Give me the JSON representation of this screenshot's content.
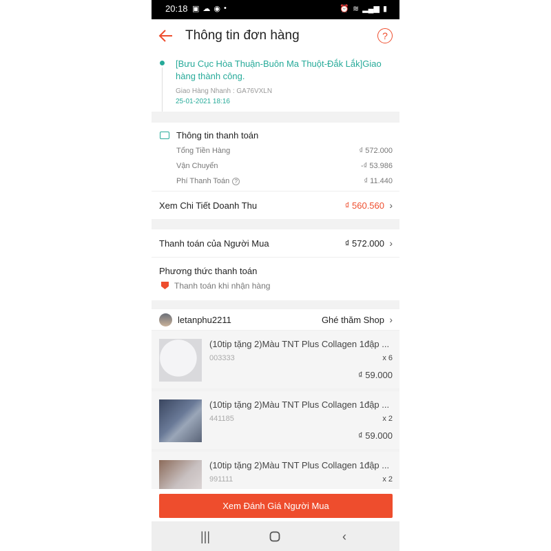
{
  "status_bar": {
    "time": "20:18",
    "icons_left": [
      "image-icon",
      "cloud-icon",
      "messenger-icon",
      "dot-icon"
    ],
    "icons_right": [
      "alarm-icon",
      "wifi-icon",
      "signal-icon",
      "battery-icon"
    ]
  },
  "header": {
    "title": "Thông tin đơn hàng"
  },
  "shipping": {
    "status": "[Bưu Cục Hòa Thuận-Buôn Ma Thuột-Đắk Lắk]Giao hàng thành công.",
    "carrier": "Giao Hàng Nhanh : GA76VXLN",
    "timestamp": "25-01-2021 18:16"
  },
  "payment": {
    "title": "Thông tin thanh toán",
    "rows": [
      {
        "label": "Tổng Tiền Hàng",
        "value": "₫ 572.000"
      },
      {
        "label": "Vận Chuyển",
        "value": "-₫ 53.986"
      },
      {
        "label": "Phí Thanh Toán",
        "value": "₫ 11.440"
      }
    ],
    "revenue_label": "Xem Chi Tiết Doanh Thu",
    "revenue_value": "₫ 560.560"
  },
  "buyer_payment": {
    "label": "Thanh toán của Người Mua",
    "value": "₫ 572.000"
  },
  "method": {
    "title": "Phương thức thanh toán",
    "value": "Thanh toán khi nhận hàng"
  },
  "shop": {
    "name": "letanphu2211",
    "visit_label": "Ghé thăm Shop"
  },
  "products": [
    {
      "name": "(10tip tặng 2)Màu TNT Plus Collagen 1đập ...",
      "variant": "003333",
      "qty": "x 6",
      "price": "₫ 59.000"
    },
    {
      "name": "(10tip tặng 2)Màu TNT Plus Collagen 1đập ...",
      "variant": "441185",
      "qty": "x 2",
      "price": "₫ 59.000"
    },
    {
      "name": "(10tip tặng 2)Màu TNT Plus Collagen 1đập ...",
      "variant": "991111",
      "qty": "x 2",
      "price": ""
    }
  ],
  "bottom_button": {
    "label": "Xem Đánh Giá Người Mua"
  },
  "colors": {
    "accent": "#ee4d2d",
    "teal": "#26aa99"
  }
}
